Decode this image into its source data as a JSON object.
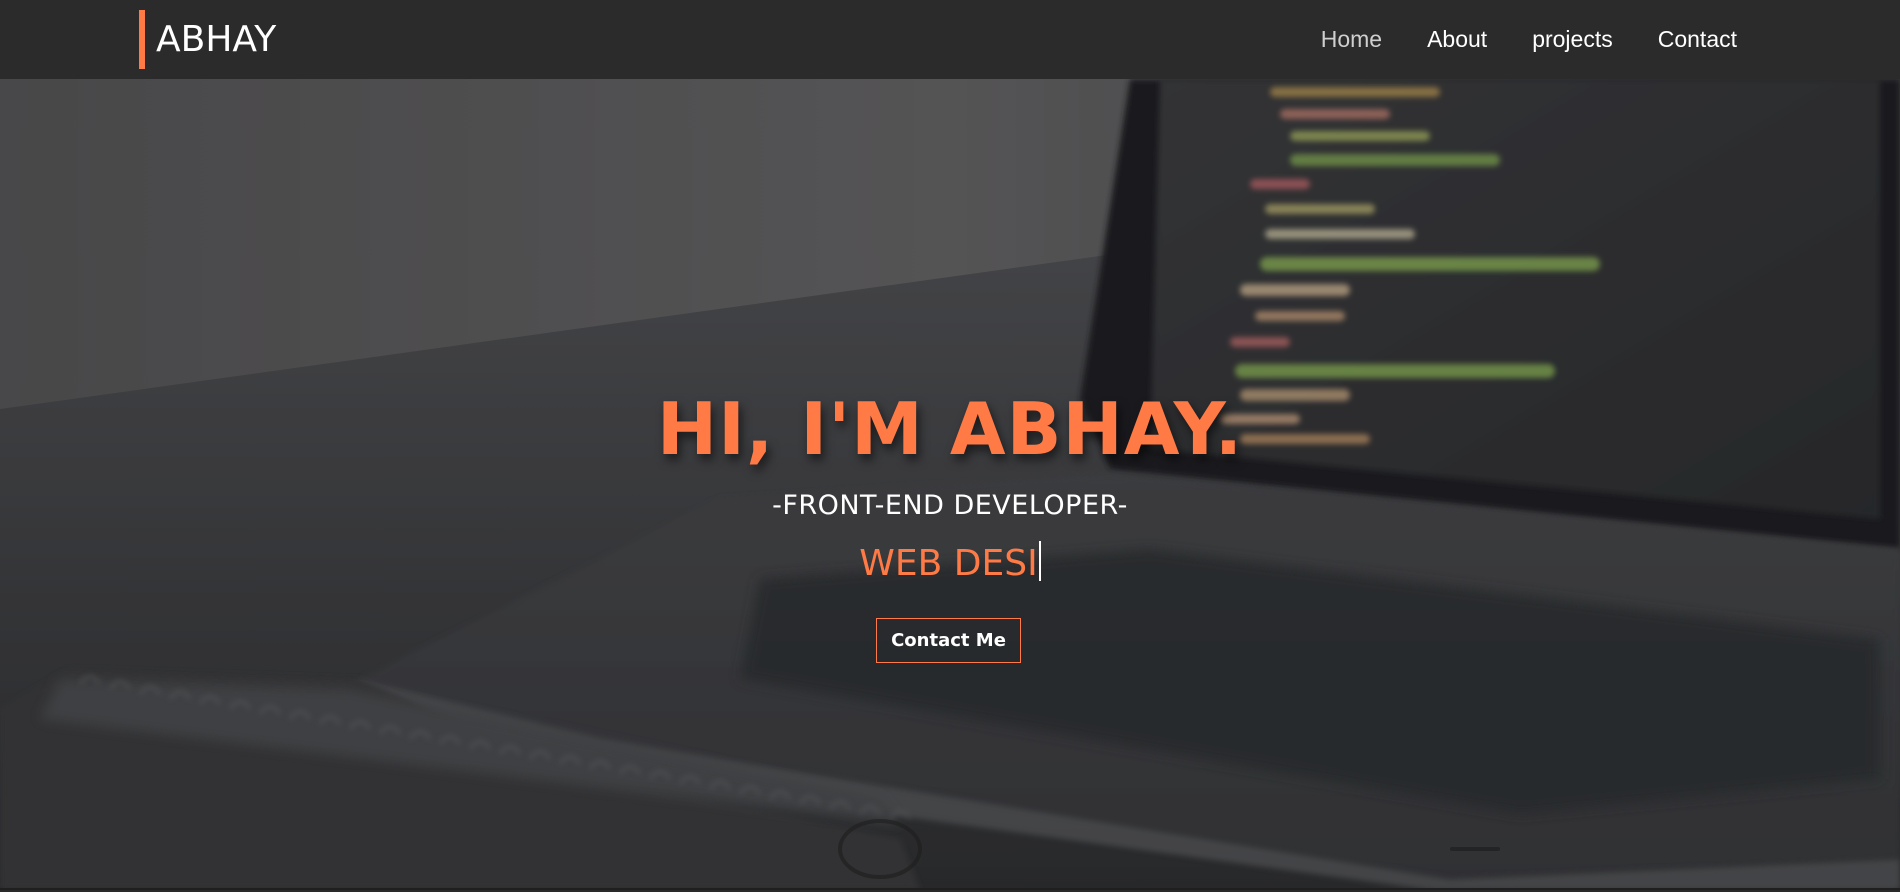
{
  "colors": {
    "accent": "#ff7a45",
    "navbar": "#2b2b2b",
    "text": "#ffffff",
    "nav_active": "#cfcfcf"
  },
  "header": {
    "brand": "ABHAY",
    "nav": [
      {
        "label": "Home",
        "active": true
      },
      {
        "label": "About",
        "active": false
      },
      {
        "label": "projects",
        "active": false
      },
      {
        "label": "Contact",
        "active": false
      }
    ]
  },
  "hero": {
    "title": "HI, I'M ABHAY.",
    "subtitle": "-FRONT-END DEVELOPER-",
    "typed_text": "WEB DESI",
    "cta_label": "Contact Me",
    "background_scene": "laptop-with-code-and-notebook"
  }
}
